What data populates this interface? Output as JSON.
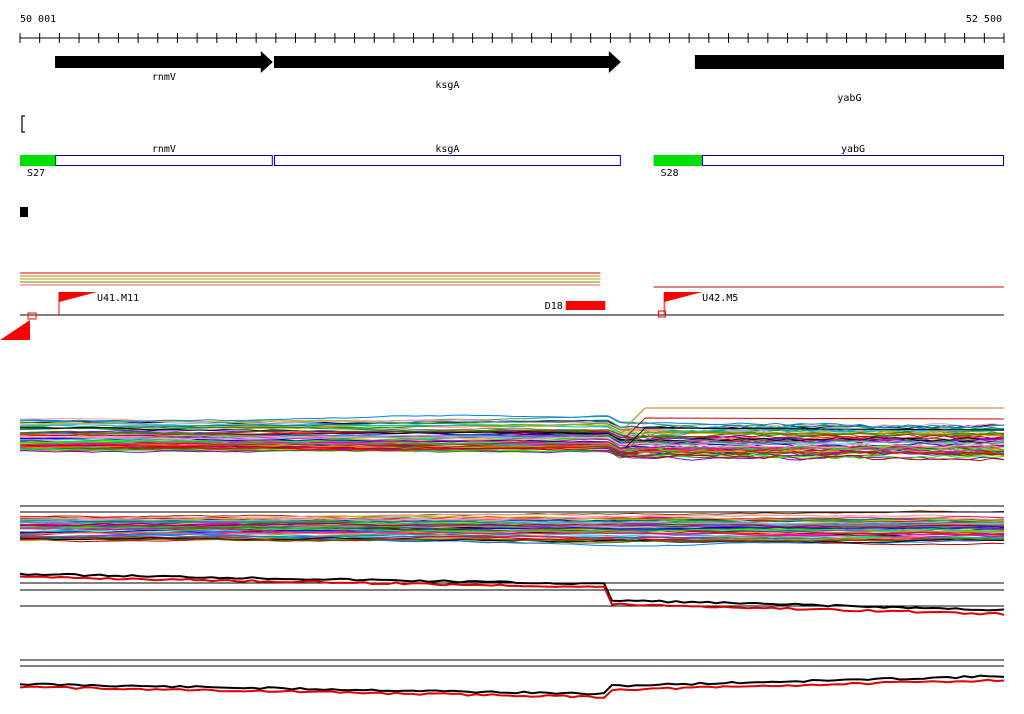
{
  "ruler": {
    "start_label": "50 001",
    "end_label": "52 500",
    "start": 50001,
    "end": 52500
  },
  "genes": [
    {
      "name": "rnmV",
      "start": 50090,
      "end": 50643,
      "strand": "+"
    },
    {
      "name": "ksgA",
      "start": 50646,
      "end": 51527,
      "strand": "+"
    },
    {
      "name": "yabG",
      "start": 51715,
      "end": 52500,
      "strand": "+"
    }
  ],
  "operons": [
    {
      "utr_label": "S27",
      "utr_start": 50001,
      "utr_end": 50090,
      "genes": [
        {
          "name": "rnmV",
          "start": 50090,
          "end": 50643
        },
        {
          "name": "ksgA",
          "start": 50646,
          "end": 51527
        }
      ]
    },
    {
      "utr_label": "S28",
      "utr_start": 51610,
      "utr_end": 51733,
      "genes": [
        {
          "name": "yabG",
          "start": 51733,
          "end": 52500
        }
      ]
    }
  ],
  "features": [
    {
      "label": "U41.M11",
      "kind": "upshift",
      "position": 50100
    },
    {
      "label": "D18",
      "kind": "downshift",
      "start": 51387,
      "end": 51487
    },
    {
      "label": "U42.M5",
      "kind": "upshift",
      "position": 51637
    }
  ],
  "colors": {
    "gene_arrow": "#000000",
    "gene_box": "#0000aa",
    "utr": "#00e000",
    "feature": "#ff0000",
    "axis": "#000000"
  },
  "tracks": [
    {
      "name": "expression-profiles-forward",
      "series_count": 60,
      "style": "multicolor"
    },
    {
      "name": "expression-profiles-reverse",
      "series_count": 60,
      "style": "multicolor"
    },
    {
      "name": "aggregate-profile-forward",
      "series_count": 2,
      "style": "black-red"
    },
    {
      "name": "aggregate-profile-reverse",
      "series_count": 2,
      "style": "black-red"
    }
  ]
}
